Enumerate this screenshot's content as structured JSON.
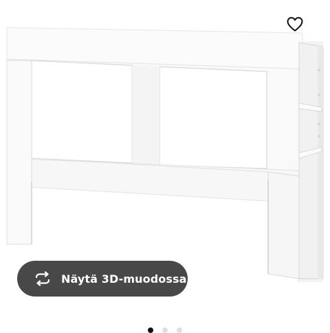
{
  "product_image": {
    "icon": "headboard-with-storage-image",
    "colors": {
      "white": "#ffffff",
      "shadow": "#e2e2e2",
      "edge": "#d4d4d4"
    }
  },
  "favourite": {
    "icon": "heart-outline-icon",
    "color": "#111111"
  },
  "view_3d_button": {
    "label": "Näytä 3D-muodossa",
    "icon": "rotate-3d-icon",
    "background": "#484848",
    "text_color": "#ffffff"
  },
  "carousel": {
    "dot_count": 3,
    "active_index": 0
  }
}
